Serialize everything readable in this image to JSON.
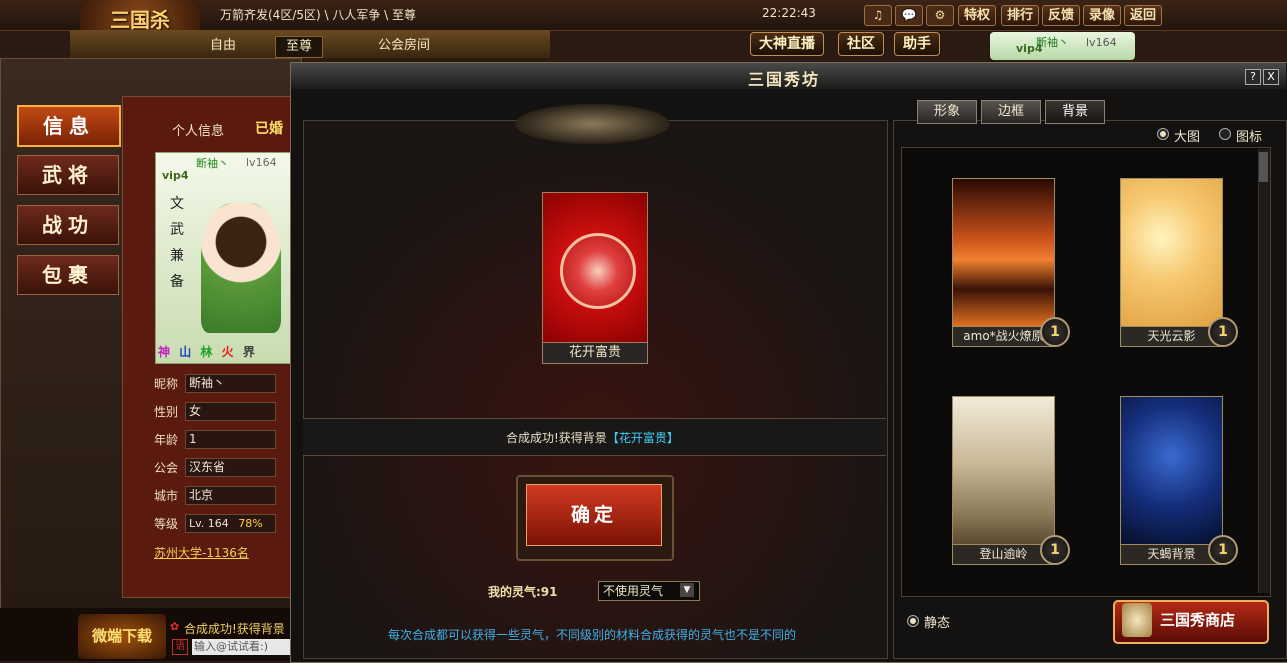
{
  "topbar": {
    "logo_text": "三国杀",
    "breadcrumb": "万箭齐发(4区/5区) \\ 八人军争 \\ 至尊",
    "clock": "22:22:43",
    "icons": [
      "music-icon",
      "chat-icon",
      "gear-icon"
    ],
    "buttons": [
      "特权",
      "排行",
      "反馈",
      "录像",
      "返回"
    ]
  },
  "subbar": {
    "tabs": [
      "自由",
      "至尊",
      "公会房间"
    ],
    "buttons": [
      "大神直播",
      "社区",
      "助手"
    ]
  },
  "user": {
    "vip": "vip4",
    "name": "断袖丶",
    "level": "lv164"
  },
  "left_nav": [
    "信息",
    "武将",
    "战功",
    "包裹"
  ],
  "profile": {
    "header": "个人信息",
    "married_badge": "已婚",
    "general_title": [
      "文",
      "武",
      "兼",
      "备"
    ],
    "tags": [
      "神",
      "山",
      "林",
      "火",
      "界"
    ],
    "fields": [
      {
        "label": "昵称",
        "value": "断袖丶"
      },
      {
        "label": "性别",
        "value": "女"
      },
      {
        "label": "年龄",
        "value": "1"
      },
      {
        "label": "公会",
        "value": "汉东省"
      },
      {
        "label": "城市",
        "value": "北京"
      },
      {
        "label": "等级",
        "value": "Lv. 164"
      }
    ],
    "level_percent": "78%",
    "school": "苏州大学-1136名"
  },
  "bottom": {
    "download_label": "微端下载",
    "chat_message": "合成成功!获得背景",
    "chat_placeholder": "输入@试试看:)"
  },
  "dialog": {
    "title": "三国秀坊",
    "help": "?",
    "close": "X",
    "selected_card": "花开富贵",
    "result_prefix": "合成成功!获得背景",
    "result_item": "【花开富贵】",
    "confirm_label": "确定",
    "qi_label": "我的灵气:91",
    "qi_select": "不使用灵气",
    "hint": "每次合成都可以获得一些灵气，不同级别的材料合成获得的灵气也不是不同的",
    "tabs": [
      "形象",
      "边框",
      "背景"
    ],
    "view_options": [
      "大图",
      "图标"
    ],
    "grid": [
      {
        "caption": "amo*战火燎原",
        "count": "1",
        "color": "#c8501a"
      },
      {
        "caption": "天光云影",
        "count": "1",
        "color": "#f0b040"
      },
      {
        "caption": "登山逾岭",
        "count": "1",
        "color": "#b8a080"
      },
      {
        "caption": "天蝎背景",
        "count": "1",
        "color": "#1a3a8a"
      }
    ],
    "static_label": "静态",
    "shop_label": "三国秀商店"
  }
}
